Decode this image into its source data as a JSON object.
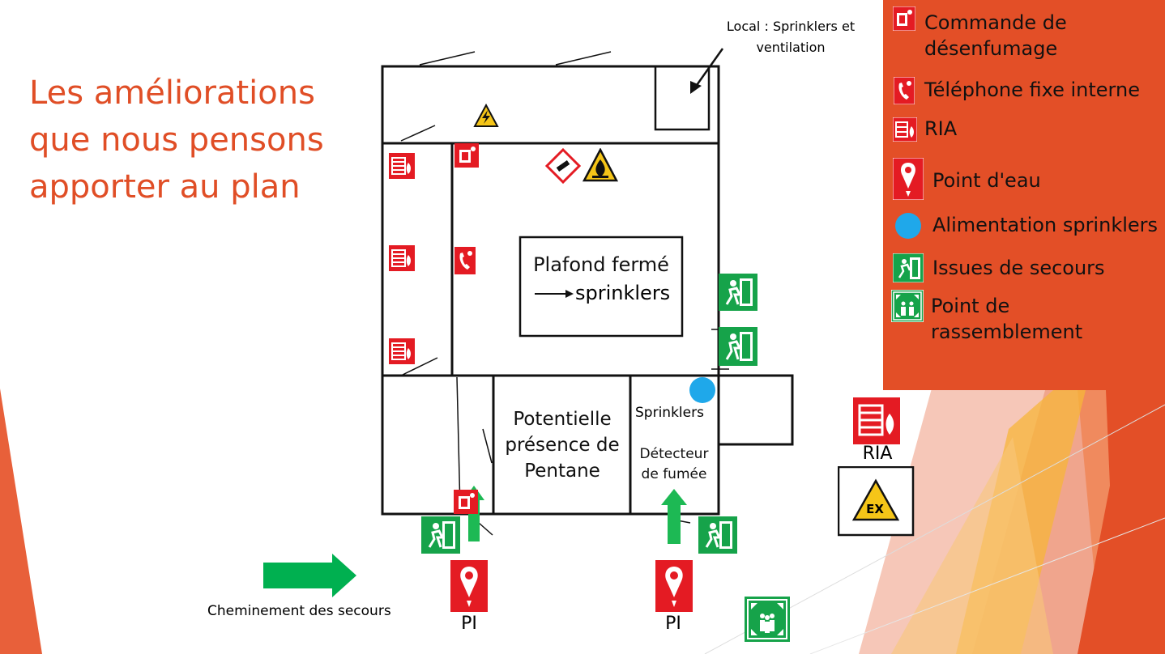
{
  "title": "Les améliorations que nous pensons apporter au plan",
  "legend": {
    "items": [
      {
        "label": "Commande de désenfumage",
        "icon": "smoke-control-icon"
      },
      {
        "label": "Téléphone fixe interne",
        "icon": "phone-icon"
      },
      {
        "label": "RIA",
        "icon": "fire-hose-icon"
      },
      {
        "label": "Point d'eau",
        "icon": "water-point-icon"
      },
      {
        "label": "Alimentation sprinklers",
        "icon": "sprinkler-dot-icon"
      },
      {
        "label": "Issues de secours",
        "icon": "emergency-exit-icon"
      },
      {
        "label": "Point de rassemblement",
        "icon": "assembly-point-icon"
      }
    ]
  },
  "plan": {
    "local_label": "Local : Sprinklers et ventilation",
    "plafond_label": "Plafond fermé",
    "plafond_arrow_label": "sprinklers",
    "pentane_label": "Potentielle présence de Pentane",
    "sprinklers_label": "Sprinklers",
    "detecteur_label": "Détecteur de fumée",
    "ria_label": "RIA",
    "pi_label": "PI",
    "route_label": "Cheminement des secours",
    "ex_label": "EX"
  },
  "colors": {
    "accent": "#e34f27",
    "title": "#e04e26",
    "exit_green": "#16a34a",
    "route_green": "#1db954",
    "sign_red": "#e41b23",
    "sprinkler_blue": "#1fa8ea",
    "warning_yellow": "#f5c518"
  }
}
